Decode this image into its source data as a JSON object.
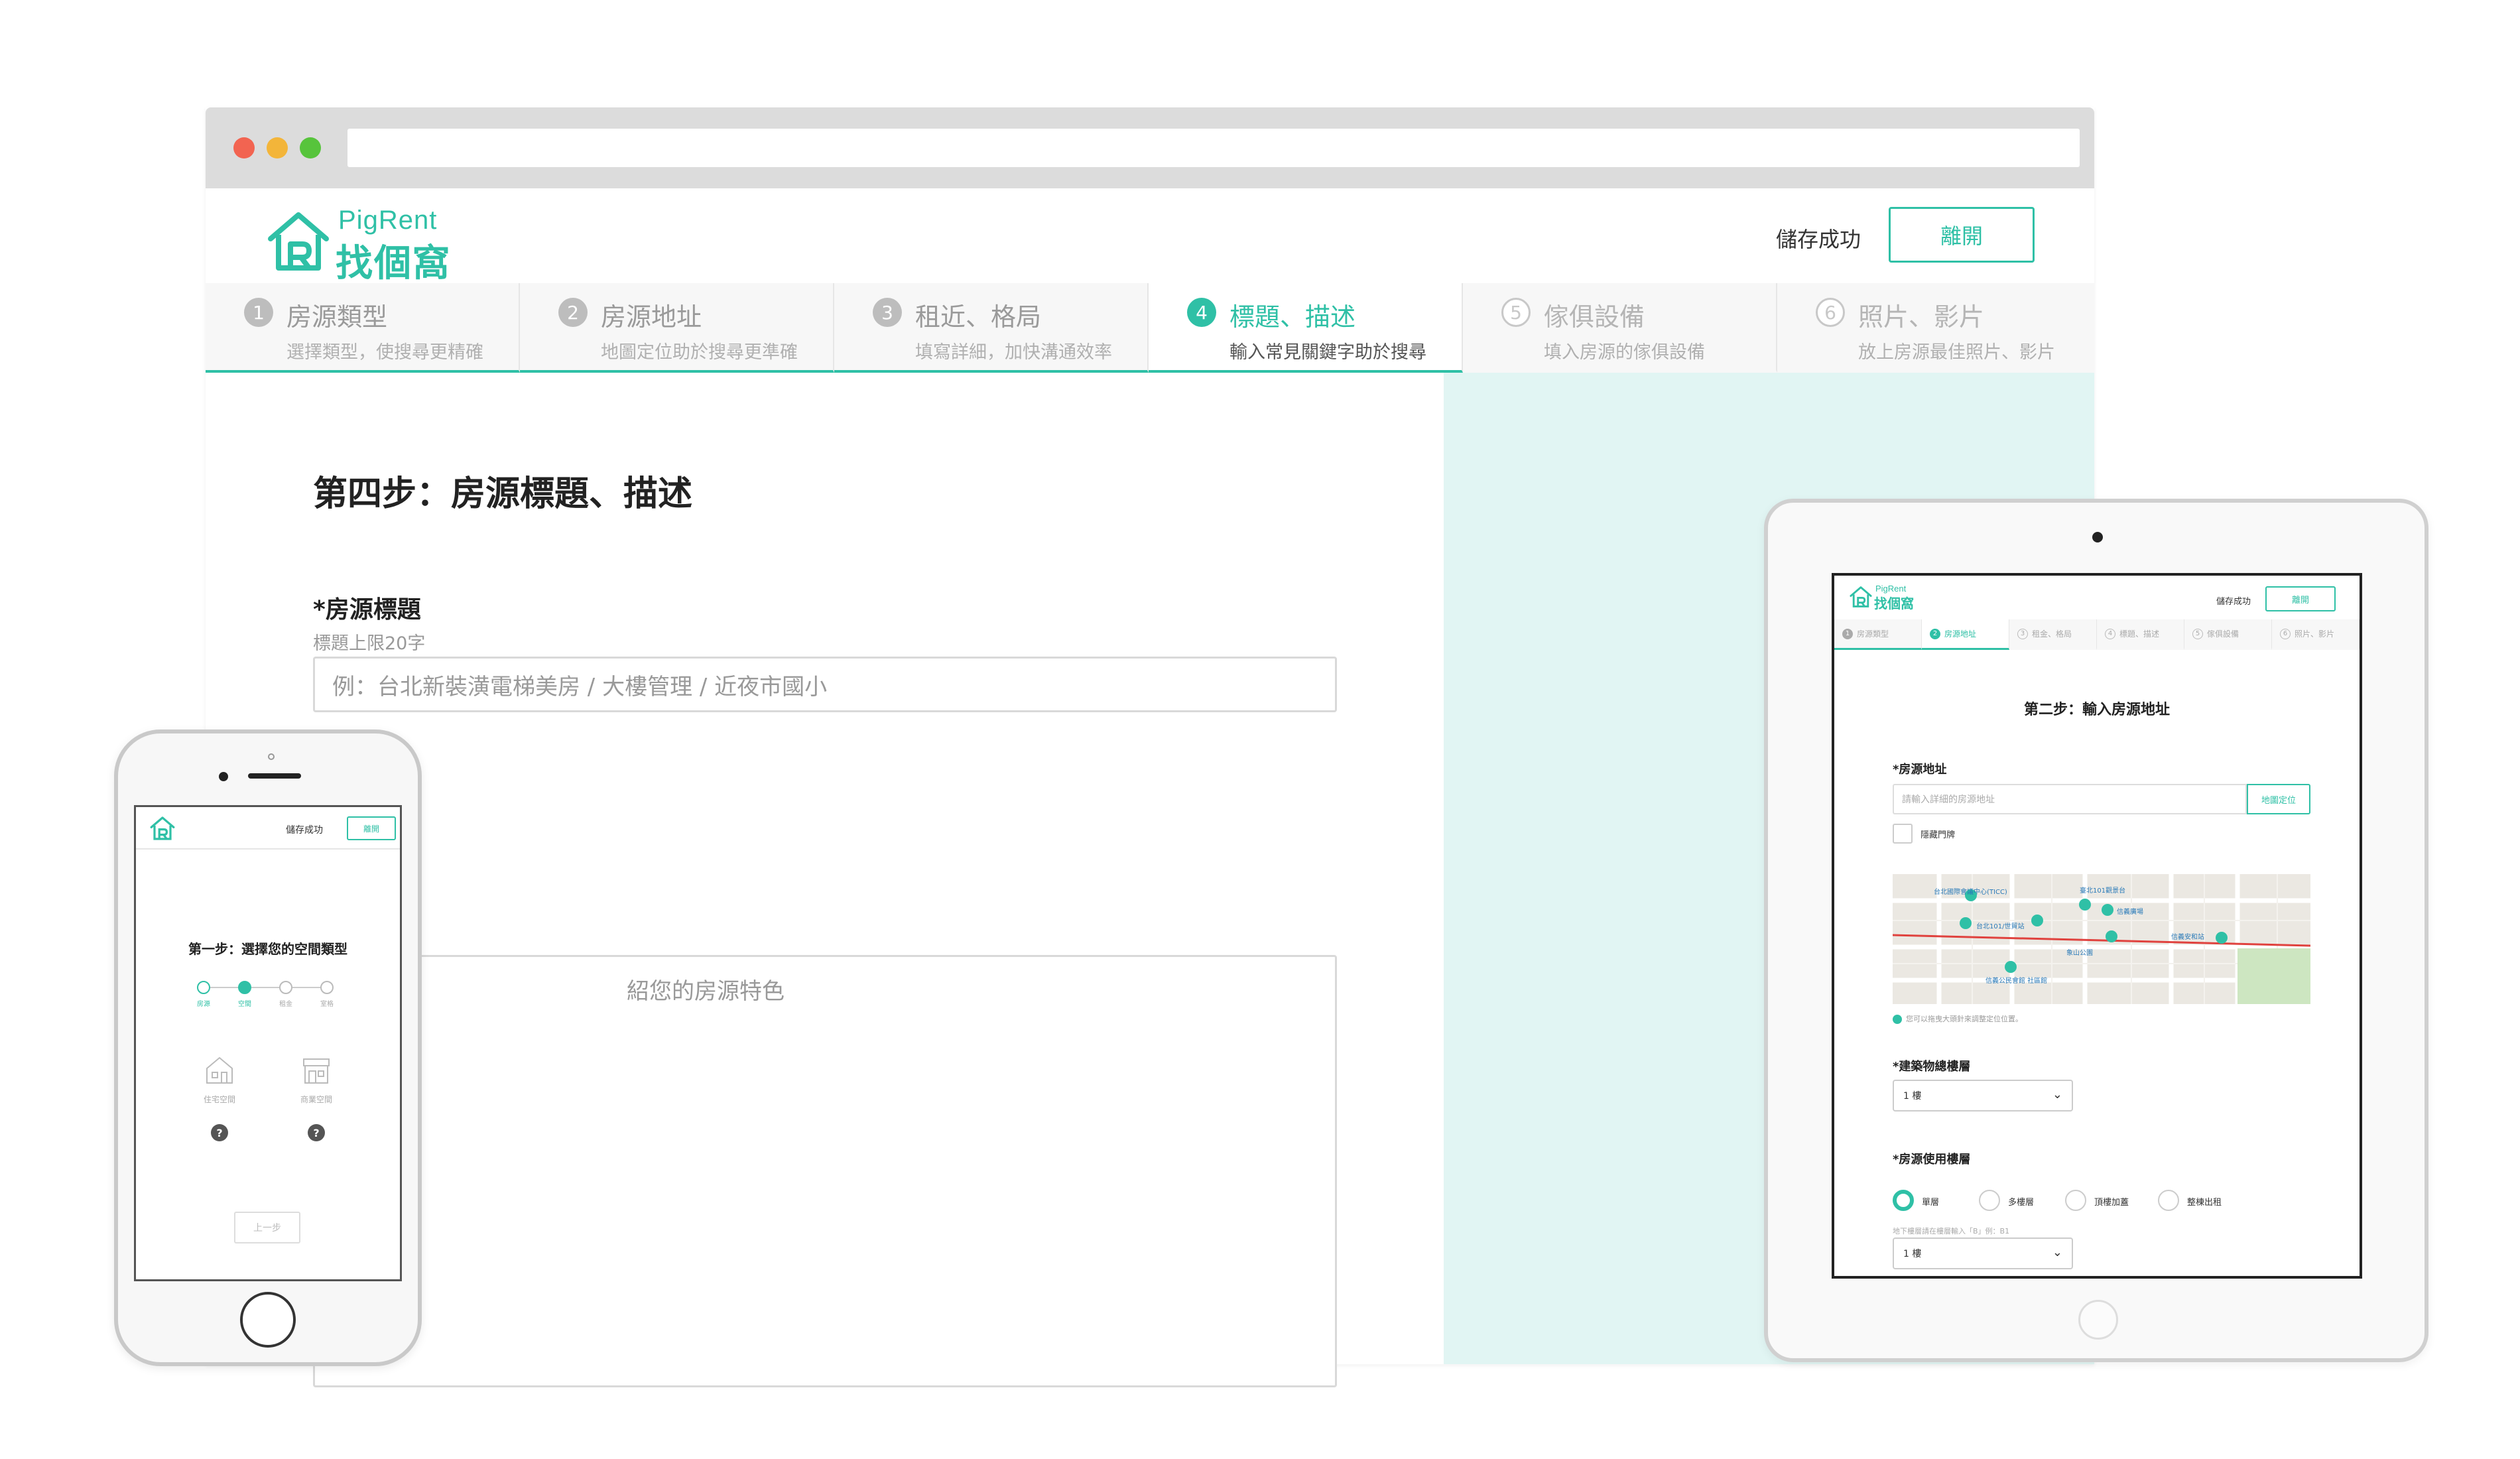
{
  "desktop": {
    "logo": {
      "en": "PigRent",
      "zh": "找個窩"
    },
    "header": {
      "save_status": "儲存成功",
      "leave_label": "離開"
    },
    "steps": [
      {
        "num": "1",
        "title": "房源類型",
        "desc": "選擇類型，使搜尋更精確"
      },
      {
        "num": "2",
        "title": "房源地址",
        "desc": "地圖定位助於搜尋更準確"
      },
      {
        "num": "3",
        "title": "租近、格局",
        "desc": "填寫詳細，加快溝通效率"
      },
      {
        "num": "4",
        "title": "標題、描述",
        "desc": "輸入常見關鍵字助於搜尋"
      },
      {
        "num": "5",
        "title": "傢俱設備",
        "desc": "填入房源的傢俱設備"
      },
      {
        "num": "6",
        "title": "照片、影片",
        "desc": "放上房源最佳照片、影片"
      }
    ],
    "form": {
      "page_title": "第四步：房源標題、描述",
      "title_label": "*房源標題",
      "title_hint": "標題上限20字",
      "title_placeholder": "例：台北新裝潢電梯美房 / 大樓管理 / 近夜市國小",
      "desc_hint_fragment": "字",
      "desc_placeholder_fragment": "紹您的房源特色"
    }
  },
  "phone": {
    "save_status": "儲存成功",
    "leave_label": "離開",
    "title": "第一步：選擇您的空間類型",
    "progress_labels": [
      "房源",
      "空間",
      "租金",
      "室格"
    ],
    "options": [
      "住宅空間",
      "商業空間"
    ],
    "help_glyph": "?",
    "prev_label": "上一步"
  },
  "tablet": {
    "logo": {
      "en": "PigRent",
      "zh": "找個窩"
    },
    "save_status": "儲存成功",
    "leave_label": "離開",
    "steps": [
      {
        "num": "1",
        "title": "房源類型"
      },
      {
        "num": "2",
        "title": "房源地址"
      },
      {
        "num": "3",
        "title": "租金、格局"
      },
      {
        "num": "4",
        "title": "標題、描述"
      },
      {
        "num": "5",
        "title": "傢俱設備"
      },
      {
        "num": "6",
        "title": "照片、影片"
      }
    ],
    "page_title": "第二步：輸入房源地址",
    "address_label": "*房源地址",
    "address_placeholder": "請輸入詳細的房源地址",
    "geo_button": "地圖定位",
    "hide_number_label": "隱藏門牌",
    "map_labels": [
      "台北國際會議中心(TICC)",
      "臺北101觀景台",
      "信義廣場",
      "台北101/世貿站",
      "信義安和站",
      "象山公園",
      "信義公民會館 社區館"
    ],
    "map_note": "您可以拖曳大頭針來調整定位位置。",
    "total_floors_label": "*建築物總樓層",
    "total_floors_value": "1 樓",
    "use_floor_label": "*房源使用樓層",
    "radio_options": [
      "單層",
      "多樓層",
      "頂樓加蓋",
      "整棟出租"
    ],
    "radio_hint": "地下樓層請在樓層輸入「B」例：B1",
    "use_floor_value": "1 樓"
  }
}
